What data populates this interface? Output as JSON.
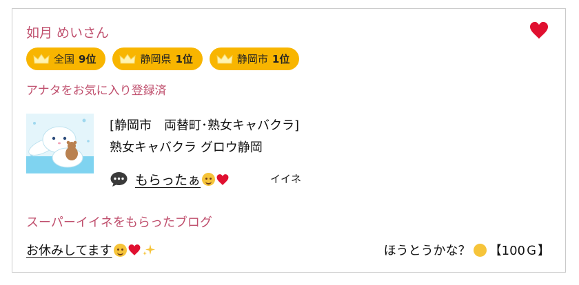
{
  "profile": {
    "name": "如月 めいさん",
    "favorite_status": "アナタをお気に入り登録済"
  },
  "rankings": [
    {
      "area": "全国",
      "rank": "9位"
    },
    {
      "area": "静岡県",
      "rank": "1位"
    },
    {
      "area": "静岡市",
      "rank": "1位"
    }
  ],
  "shop": {
    "area_line": "[静岡市　両替町･熟女キャバクラ]",
    "name": "熟女キャバクラ グロウ静岡"
  },
  "comment": {
    "text": "もらったぁ",
    "like_label": "イイネ"
  },
  "super_like": {
    "title": "スーパーイイネをもらったブログ",
    "blog_title": "お休みしてます",
    "blog_comment": "ほうとうかな？",
    "points": "【100Ｇ】"
  },
  "colors": {
    "accent": "#c0506e",
    "badge": "#f8b500",
    "heart": "#e01030"
  },
  "icons": [
    "heart-icon",
    "crown-icon",
    "chat-bubble-icon",
    "sparkle-icon"
  ]
}
